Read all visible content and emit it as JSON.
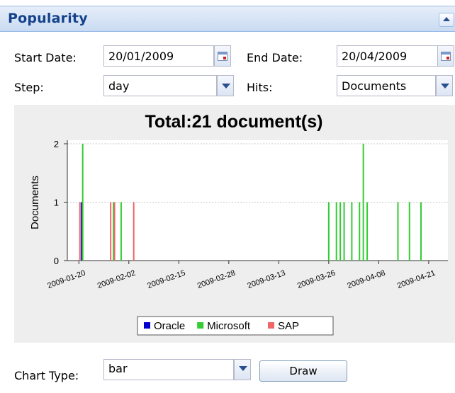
{
  "panel": {
    "title": "Popularity"
  },
  "filters": {
    "start_label": "Start Date:",
    "start_value": "20/01/2009",
    "end_label": "End Date:",
    "end_value": "20/04/2009",
    "step_label": "Step:",
    "step_value": "day",
    "hits_label": "Hits:",
    "hits_value": "Documents"
  },
  "chart_data": {
    "type": "bar",
    "title": "Total:21 document(s)",
    "xlabel": "",
    "ylabel": "Documents",
    "ylim": [
      0,
      2
    ],
    "yticks": [
      "0",
      "1",
      "2"
    ],
    "xticks": [
      "2009-01-20",
      "2009-02-02",
      "2009-02-15",
      "2009-02-28",
      "2009-03-13",
      "2009-03-26",
      "2009-04-08",
      "2009-04-21"
    ],
    "grid": true,
    "legend_position": "bottom",
    "series": [
      {
        "name": "Oracle",
        "color": "#0000cc",
        "points": [
          {
            "x": "2009-01-21",
            "y": 1
          }
        ]
      },
      {
        "name": "Microsoft",
        "color": "#33cc33",
        "points": [
          {
            "x": "2009-01-21",
            "y": 2
          },
          {
            "x": "2009-01-29",
            "y": 1
          },
          {
            "x": "2009-01-31",
            "y": 1
          },
          {
            "x": "2009-03-26",
            "y": 1
          },
          {
            "x": "2009-03-28",
            "y": 1
          },
          {
            "x": "2009-03-29",
            "y": 1
          },
          {
            "x": "2009-03-30",
            "y": 1
          },
          {
            "x": "2009-04-01",
            "y": 1
          },
          {
            "x": "2009-04-03",
            "y": 1
          },
          {
            "x": "2009-04-04",
            "y": 2
          },
          {
            "x": "2009-04-05",
            "y": 1
          },
          {
            "x": "2009-04-13",
            "y": 1
          },
          {
            "x": "2009-04-16",
            "y": 1
          },
          {
            "x": "2009-04-19",
            "y": 1
          }
        ]
      },
      {
        "name": "SAP",
        "color": "#ee6666",
        "points": [
          {
            "x": "2009-01-20",
            "y": 1
          },
          {
            "x": "2009-01-28",
            "y": 1
          },
          {
            "x": "2009-01-29",
            "y": 1
          },
          {
            "x": "2009-02-03",
            "y": 1
          }
        ]
      }
    ]
  },
  "chart_controls": {
    "type_label": "Chart Type:",
    "type_value": "bar",
    "draw_label": "Draw"
  }
}
